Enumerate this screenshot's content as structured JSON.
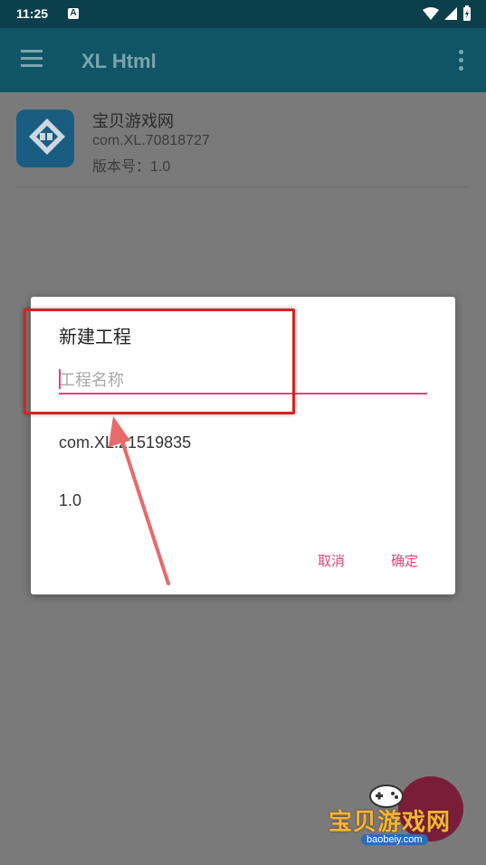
{
  "status_bar": {
    "time": "11:25",
    "notification": "A"
  },
  "toolbar": {
    "title": "XL Html"
  },
  "project": {
    "name": "宝贝游戏网",
    "package": "com.XL.70818727",
    "version": "版本号：1.0"
  },
  "dialog": {
    "title": "新建工程",
    "name_placeholder": "工程名称",
    "package": "com.XL.21519835",
    "version": "1.0",
    "cancel_label": "取消",
    "ok_label": "确定"
  },
  "watermark": {
    "text": "宝贝游戏网",
    "sub": "baobeiy.com"
  },
  "colors": {
    "toolbar": "#0f5566",
    "statusbar": "#0c3f4c",
    "accent": "#e0457a",
    "highlight": "#d62424"
  }
}
